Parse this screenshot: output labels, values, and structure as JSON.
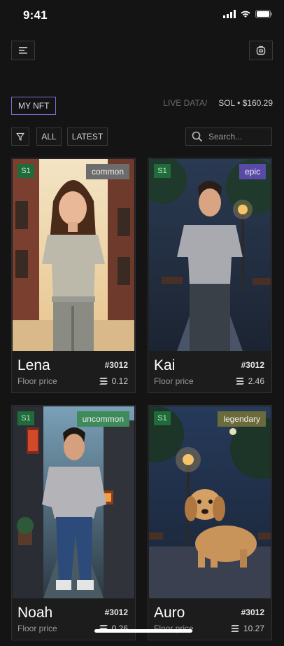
{
  "status": {
    "time": "9:41"
  },
  "header": {
    "menu_icon": "menu-icon",
    "wallet_icon": "wallet-icon"
  },
  "tabs": {
    "my_nft": "MY NFT"
  },
  "market": {
    "live_data": "LIVE DATA/",
    "sol_price": "SOL • $160.29"
  },
  "filters": {
    "all": "ALL",
    "latest": "LATEST"
  },
  "search": {
    "placeholder": "Search..."
  },
  "accent": "#7b6fd6",
  "nfts": [
    {
      "season": "S1",
      "rarity": "common",
      "name": "Lena",
      "id": "#3012",
      "floor_label": "Floor price",
      "price": "0.12"
    },
    {
      "season": "S1",
      "rarity": "epic",
      "name": "Kai",
      "id": "#3012",
      "floor_label": "Floor price",
      "price": "2.46"
    },
    {
      "season": "S1",
      "rarity": "uncommon",
      "name": "Noah",
      "id": "#3012",
      "floor_label": "Floor price",
      "price": "0.26"
    },
    {
      "season": "S1",
      "rarity": "legendary",
      "name": "Auro",
      "id": "#3012",
      "floor_label": "Floor price",
      "price": "10.27"
    }
  ]
}
